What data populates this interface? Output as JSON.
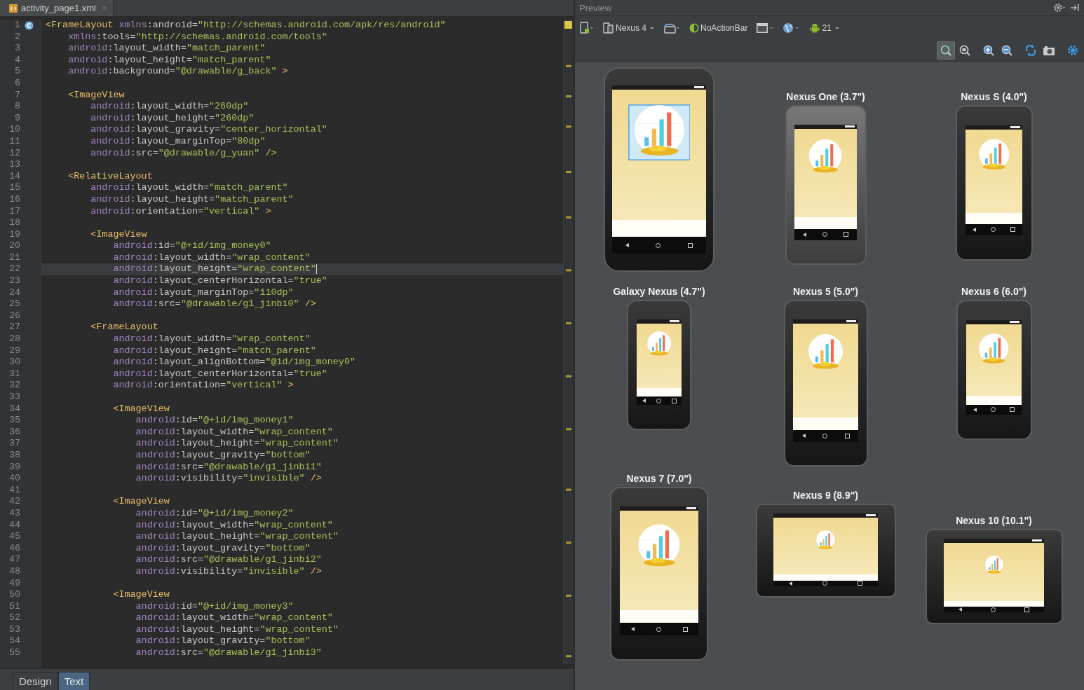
{
  "editor": {
    "tab": {
      "title": "activity_page1.xml",
      "close": "×"
    },
    "lines": [
      {
        "number": "1",
        "text": "<FrameLayout xmlns:android=\"http://schemas.android.com/apk/res/android\"",
        "current": false
      },
      {
        "number": "2",
        "text": "    xmlns:tools=\"http://schemas.android.com/tools\"",
        "current": false
      },
      {
        "number": "3",
        "text": "    android:layout_width=\"match_parent\"",
        "current": false
      },
      {
        "number": "4",
        "text": "    android:layout_height=\"match_parent\"",
        "current": false
      },
      {
        "number": "5",
        "text": "    android:background=\"@drawable/g_back\" >",
        "current": false
      },
      {
        "number": "6",
        "current": false
      },
      {
        "number": "7",
        "text": "    <ImageView",
        "current": false
      },
      {
        "number": "8",
        "text": "        android:layout_width=\"260dp\"",
        "current": false
      },
      {
        "number": "9",
        "text": "        android:layout_height=\"260dp\"",
        "current": false
      },
      {
        "number": "10",
        "text": "        android:layout_gravity=\"center_horizontal\"",
        "current": false
      },
      {
        "number": "11",
        "text": "        android:layout_marginTop=\"80dp\"",
        "current": false
      },
      {
        "number": "12",
        "text": "        android:src=\"@drawable/g_yuan\" />",
        "current": false
      },
      {
        "number": "13",
        "current": false
      },
      {
        "number": "14",
        "text": "    <RelativeLayout",
        "current": false
      },
      {
        "number": "15",
        "text": "        android:layout_width=\"match_parent\"",
        "current": false
      },
      {
        "number": "16",
        "text": "        android:layout_height=\"match_parent\"",
        "current": false
      },
      {
        "number": "17",
        "text": "        android:orientation=\"vertical\" >",
        "current": false
      },
      {
        "number": "18",
        "current": false
      },
      {
        "number": "19",
        "text": "        <ImageView",
        "current": false
      },
      {
        "number": "20",
        "text": "            android:id=\"@+id/img_money0\"",
        "current": false
      },
      {
        "number": "21",
        "text": "            android:layout_width=\"wrap_content\"",
        "current": false
      },
      {
        "number": "22",
        "text": "            android:layout_height=\"wrap_content\"",
        "current": true
      },
      {
        "number": "23",
        "text": "            android:layout_centerHorizontal=\"true\"",
        "current": false
      },
      {
        "number": "24",
        "text": "            android:layout_marginTop=\"110dp\"",
        "current": false
      },
      {
        "number": "25",
        "text": "            android:src=\"@drawable/g1_jinbi0\" />",
        "current": false
      },
      {
        "number": "26",
        "current": false
      },
      {
        "number": "27",
        "text": "        <FrameLayout",
        "current": false
      },
      {
        "number": "28",
        "text": "            android:layout_width=\"wrap_content\"",
        "current": false
      },
      {
        "number": "29",
        "text": "            android:layout_height=\"match_parent\"",
        "current": false
      },
      {
        "number": "30",
        "text": "            android:layout_alignBottom=\"@id/img_money0\"",
        "current": false
      },
      {
        "number": "31",
        "text": "            android:layout_centerHorizontal=\"true\"",
        "current": false
      },
      {
        "number": "32",
        "text": "            android:orientation=\"vertical\" >",
        "current": false
      },
      {
        "number": "33",
        "current": false
      },
      {
        "number": "34",
        "text": "            <ImageView",
        "current": false
      },
      {
        "number": "35",
        "text": "                android:id=\"@+id/img_money1\"",
        "current": false
      },
      {
        "number": "36",
        "text": "                android:layout_width=\"wrap_content\"",
        "current": false
      },
      {
        "number": "37",
        "text": "                android:layout_height=\"wrap_content\"",
        "current": false
      },
      {
        "number": "38",
        "text": "                android:layout_gravity=\"bottom\"",
        "current": false
      },
      {
        "number": "39",
        "text": "                android:src=\"@drawable/g1_jinbi1\"",
        "current": false
      },
      {
        "number": "40",
        "text": "                android:visibility=\"invisible\" />",
        "current": false
      },
      {
        "number": "41",
        "current": false
      },
      {
        "number": "42",
        "text": "            <ImageView",
        "current": false
      },
      {
        "number": "43",
        "text": "                android:id=\"@+id/img_money2\"",
        "current": false
      },
      {
        "number": "44",
        "text": "                android:layout_width=\"wrap_content\"",
        "current": false
      },
      {
        "number": "45",
        "text": "                android:layout_height=\"wrap_content\"",
        "current": false
      },
      {
        "number": "46",
        "text": "                android:layout_gravity=\"bottom\"",
        "current": false
      },
      {
        "number": "47",
        "text": "                android:src=\"@drawable/g1_jinbi2\"",
        "current": false
      },
      {
        "number": "48",
        "text": "                android:visibility=\"invisible\" />",
        "current": false
      },
      {
        "number": "49",
        "current": false
      },
      {
        "number": "50",
        "text": "            <ImageView",
        "current": false
      },
      {
        "number": "51",
        "text": "                android:id=\"@+id/img_money3\"",
        "current": false
      },
      {
        "number": "52",
        "text": "                android:layout_width=\"wrap_content\"",
        "current": false
      },
      {
        "number": "53",
        "text": "                android:layout_height=\"wrap_content\"",
        "current": false
      },
      {
        "number": "54",
        "text": "                android:layout_gravity=\"bottom\"",
        "current": false
      },
      {
        "number": "55",
        "text": "                android:src=\"@drawable/g1_jinbi3\"",
        "current": false
      }
    ],
    "bottom_tabs": [
      {
        "label": "Design",
        "selected": false
      },
      {
        "label": "Text",
        "selected": true
      }
    ]
  },
  "preview": {
    "title": "Preview",
    "toolbar": {
      "device": "Nexus 4",
      "theme": "NoActionBar",
      "api": "21"
    },
    "devices": [
      {
        "kind": "phone",
        "selected": true
      },
      {
        "name": "Nexus One (3.7\")",
        "kind": "phone",
        "selected": false
      },
      {
        "name": "Nexus S (4.0\")",
        "kind": "phone",
        "selected": false
      },
      {
        "name": "Galaxy Nexus (4.7\")",
        "kind": "phone",
        "selected": false
      },
      {
        "name": "Nexus 5 (5.0\")",
        "kind": "phone",
        "selected": false
      },
      {
        "name": "Nexus 6 (6.0\")",
        "kind": "phone",
        "selected": false
      },
      {
        "name": "Nexus 7 (7.0\")",
        "kind": "phone",
        "selected": false
      },
      {
        "name": "Nexus 9 (8.9\")",
        "kind": "tablet",
        "selected": false
      },
      {
        "name": "Nexus 10 (10.1\")",
        "kind": "tablet",
        "selected": false
      }
    ]
  }
}
